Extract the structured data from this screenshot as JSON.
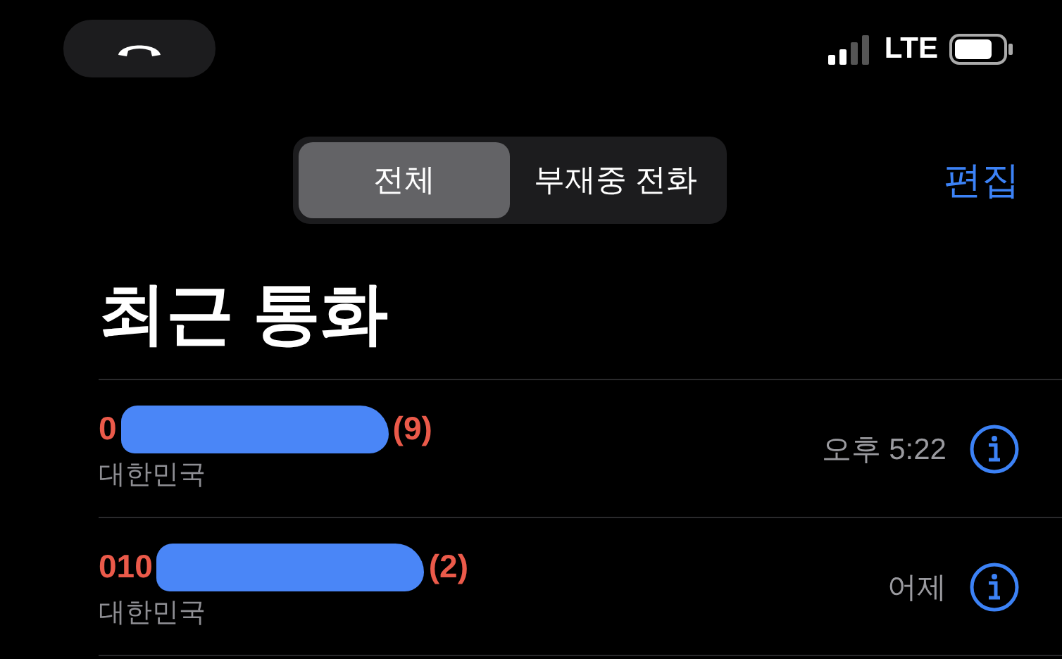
{
  "status_bar": {
    "network": "LTE"
  },
  "segments": [
    {
      "label": "전체",
      "selected": true
    },
    {
      "label": "부재중 전화",
      "selected": false
    }
  ],
  "edit_button": "편집",
  "title": "최근 통화",
  "calls": [
    {
      "number": "0",
      "count": "(9)",
      "location": "대한민국",
      "time": "오후 5:22",
      "missed": true
    },
    {
      "number": "010",
      "count": "(2)",
      "location": "대한민국",
      "time": "어제",
      "missed": true
    }
  ]
}
